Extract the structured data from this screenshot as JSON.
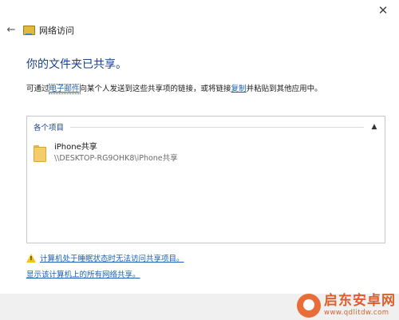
{
  "window": {
    "title": "网络访问",
    "close_glyph": "✕",
    "back_glyph": "←"
  },
  "main": {
    "heading": "你的文件夹已共享。",
    "description": {
      "part1": "可通过",
      "email_link": "电子邮件",
      "part2": "向某个人发送到这些共享项的链接，或将链接",
      "copy_link": "复制",
      "part3": "并粘贴到其他应用中。"
    }
  },
  "items_panel": {
    "group_label": "各个项目",
    "collapse_glyph": "▲",
    "items": [
      {
        "name": "iPhone共享",
        "path": "\\\\DESKTOP-RG9OHK8\\iPhone共享",
        "icon": "folder-icon"
      }
    ]
  },
  "footer_links": {
    "warning_glyph": "!",
    "sleep_warning": "计算机处于睡眠状态时无法访问共享项目。",
    "show_all_shares": "显示该计算机上的所有网络共享。"
  },
  "watermark": {
    "title": "启东安卓网",
    "url": "www.qdlitdw.com"
  },
  "colors": {
    "heading": "#1c3f8a",
    "link": "#1a5fb4",
    "warning": "#f0c419",
    "folder": "#f4cd6b",
    "watermark": "#d9531e"
  }
}
